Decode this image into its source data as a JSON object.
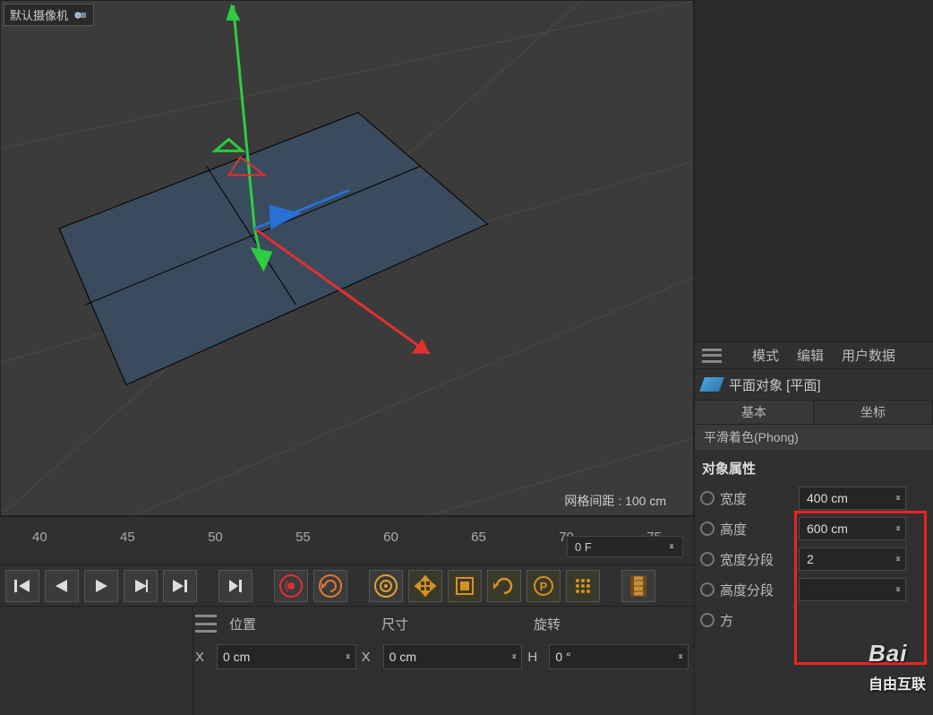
{
  "viewport": {
    "camera_label": "默认摄像机",
    "grid_label": "网格间距 : 100 cm"
  },
  "timeline": {
    "ticks": [
      "40",
      "45",
      "50",
      "55",
      "60",
      "65",
      "70",
      "75"
    ],
    "current_frame": "0 F"
  },
  "coordbar": {
    "headers": {
      "pos": "位置",
      "size": "尺寸",
      "rot": "旋转"
    },
    "pos": {
      "axis": "X",
      "val": "0 cm"
    },
    "size": {
      "axis": "X",
      "val": "0 cm"
    },
    "rot": {
      "axis": "H",
      "val": "0 °"
    }
  },
  "attr": {
    "menu": {
      "mode": "模式",
      "edit": "编辑",
      "user": "用户数据"
    },
    "object_label": "平面对象 [平面]",
    "tabs": {
      "basic": "基本",
      "coord": "坐标"
    },
    "phong": "平滑着色(Phong)",
    "section": "对象属性",
    "props": {
      "width": {
        "label": "宽度",
        "val": "400 cm"
      },
      "height": {
        "label": "高度",
        "val": "600 cm"
      },
      "wseg": {
        "label": "宽度分段",
        "val": "2"
      },
      "hseg": {
        "label": "高度分段",
        "val": ""
      },
      "dir": {
        "label": "方"
      }
    }
  },
  "watermark": {
    "brand": "Bai",
    "text": "自由互联"
  }
}
